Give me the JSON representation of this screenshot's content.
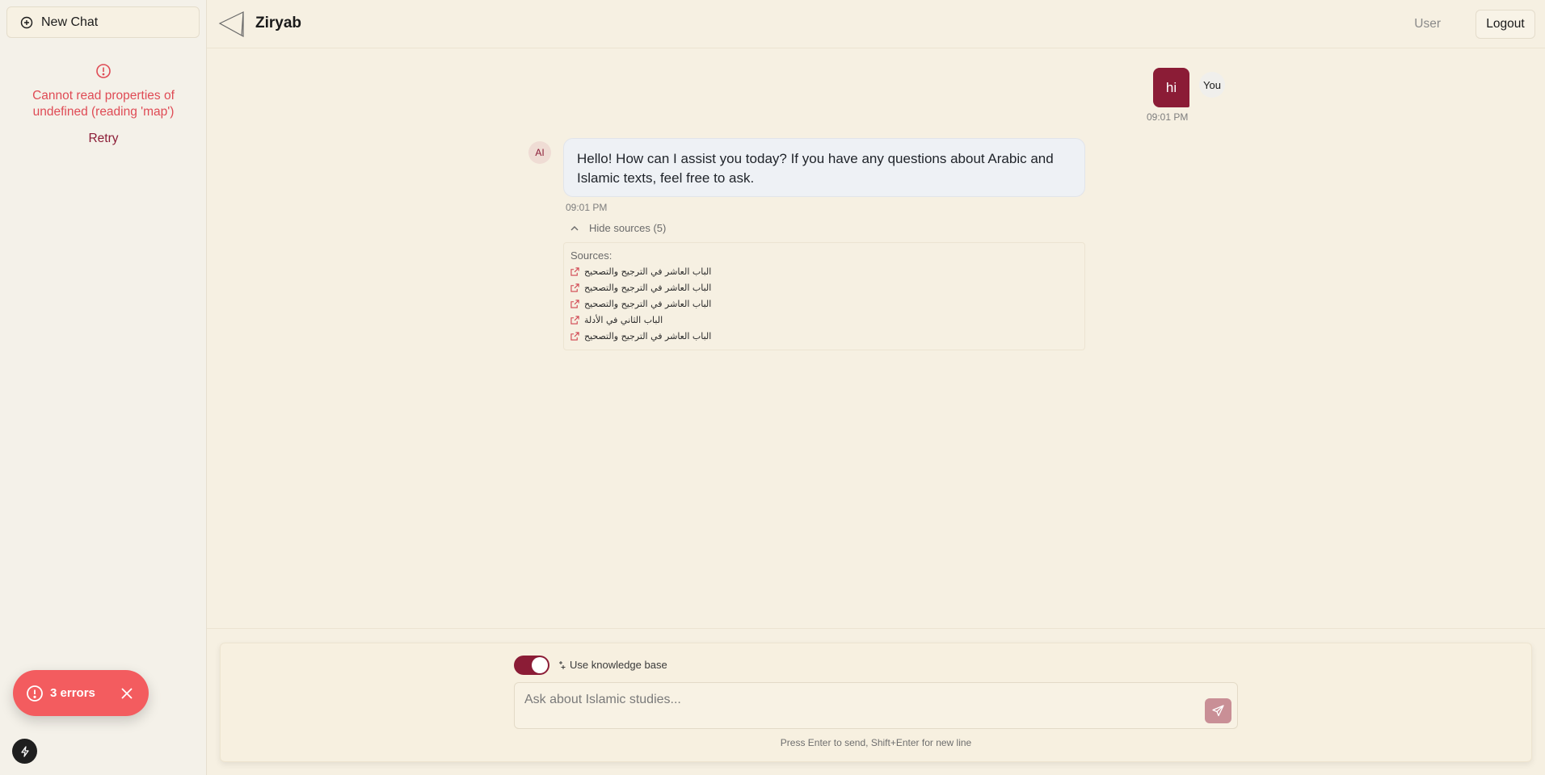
{
  "sidebar": {
    "new_chat_label": "New Chat",
    "error_message": "Cannot read properties of undefined (reading 'map')",
    "retry_label": "Retry"
  },
  "header": {
    "title": "Ziryab",
    "user_label": "User",
    "logout_label": "Logout"
  },
  "messages": {
    "user": {
      "text": "hi",
      "avatar_label": "You",
      "time": "09:01 PM"
    },
    "ai": {
      "avatar_label": "AI",
      "text": "Hello! How can I assist you today? If you have any questions about Arabic and Islamic texts, feel free to ask.",
      "time": "09:01 PM",
      "hide_sources_label": "Hide sources (5)",
      "sources_title": "Sources:",
      "sources": [
        "الباب العاشر في الترجيح والتصحيح",
        "الباب العاشر في الترجيح والتصحيح",
        "الباب العاشر في الترجيح والتصحيح",
        "الباب الثاني في الأدلة",
        "الباب العاشر في الترجيح والتصحيح"
      ]
    }
  },
  "composer": {
    "toggle_on": true,
    "knowledge_base_label": "Use knowledge base",
    "placeholder": "Ask about Islamic studies...",
    "hint": "Press Enter to send, Shift+Enter for new line"
  },
  "errors_toast": {
    "label": "3 errors"
  },
  "colors": {
    "brand": "#8b1c36",
    "error": "#df4b55",
    "toast": "#f35c5f",
    "background": "#f6f0e2"
  }
}
